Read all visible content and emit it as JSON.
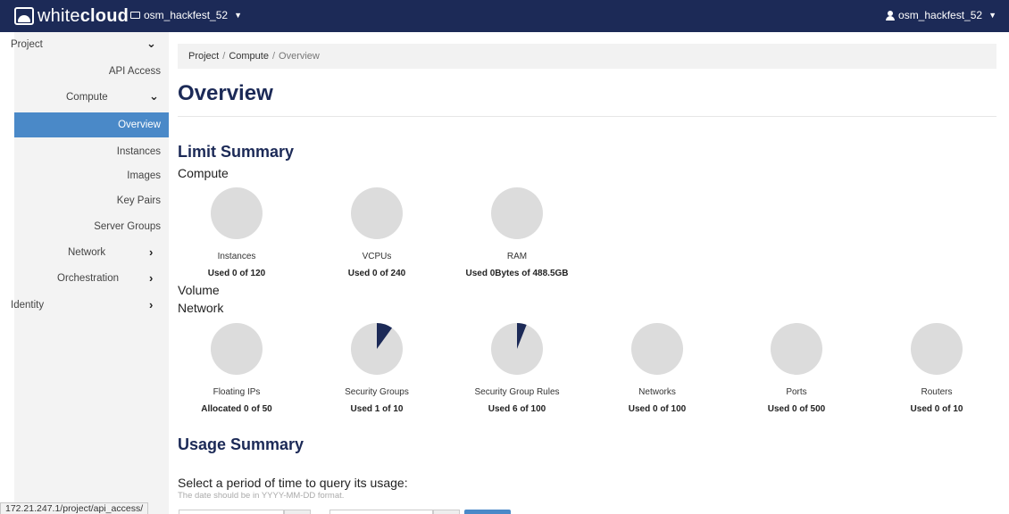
{
  "topbar": {
    "logo_light": "white",
    "logo_bold": "cloud",
    "project": "osm_hackfest_52",
    "user": "osm_hackfest_52"
  },
  "sidebar": {
    "project": "Project",
    "api_access": "API Access",
    "compute": "Compute",
    "overview": "Overview",
    "instances": "Instances",
    "images": "Images",
    "key_pairs": "Key Pairs",
    "server_groups": "Server Groups",
    "network": "Network",
    "orchestration": "Orchestration",
    "identity": "Identity"
  },
  "breadcrumb": {
    "project": "Project",
    "compute": "Compute",
    "current": "Overview"
  },
  "page_title": "Overview",
  "limit_summary": {
    "title": "Limit Summary",
    "compute_heading": "Compute",
    "volume_heading": "Volume",
    "network_heading": "Network",
    "compute": [
      {
        "label": "Instances",
        "used": "Used 0 of 120",
        "fraction": 0
      },
      {
        "label": "VCPUs",
        "used": "Used 0 of 240",
        "fraction": 0
      },
      {
        "label": "RAM",
        "used": "Used 0Bytes of 488.5GB",
        "fraction": 0
      }
    ],
    "network": [
      {
        "label": "Floating IPs",
        "used": "Allocated 0 of 50",
        "fraction": 0
      },
      {
        "label": "Security Groups",
        "used": "Used 1 of 10",
        "fraction": 0.1
      },
      {
        "label": "Security Group Rules",
        "used": "Used 6 of 100",
        "fraction": 0.06
      },
      {
        "label": "Networks",
        "used": "Used 0 of 100",
        "fraction": 0
      },
      {
        "label": "Ports",
        "used": "Used 0 of 500",
        "fraction": 0
      },
      {
        "label": "Routers",
        "used": "Used 0 of 10",
        "fraction": 0
      }
    ]
  },
  "usage_summary": {
    "title": "Usage Summary",
    "query_title": "Select a period of time to query its usage:",
    "help": "The date should be in YYYY-MM-DD format."
  },
  "status_url": "172.21.247.1/project/api_access/",
  "colors": {
    "brand": "#1c2a57",
    "active": "#4a89c8",
    "gauge_bg": "#dcdcdc",
    "gauge_fill": "#1c2a57"
  }
}
